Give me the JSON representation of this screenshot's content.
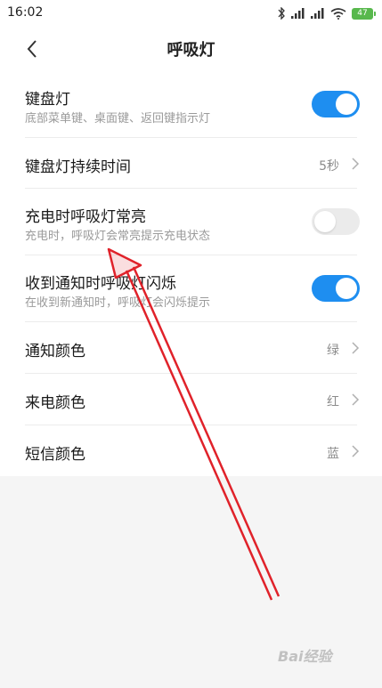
{
  "status_bar": {
    "time": "16:02",
    "battery": "47"
  },
  "header": {
    "title": "呼吸灯"
  },
  "rows": [
    {
      "title": "键盘灯",
      "subtitle": "底部菜单键、桌面键、返回键指示灯",
      "toggle": "on"
    },
    {
      "title": "键盘灯持续时间",
      "value": "5秒"
    },
    {
      "title": "充电时呼吸灯常亮",
      "subtitle": "充电时，呼吸灯会常亮提示充电状态",
      "toggle": "off"
    },
    {
      "title": "收到通知时呼吸灯闪烁",
      "subtitle": "在收到新通知时，呼吸灯会闪烁提示",
      "toggle": "on"
    },
    {
      "title": "通知颜色",
      "value": "绿"
    },
    {
      "title": "来电颜色",
      "value": "红"
    },
    {
      "title": "短信颜色",
      "value": "蓝"
    }
  ],
  "watermark": "Bai经验",
  "colors": {
    "accent": "#1e8ef0",
    "arrow": "#e0222a"
  }
}
